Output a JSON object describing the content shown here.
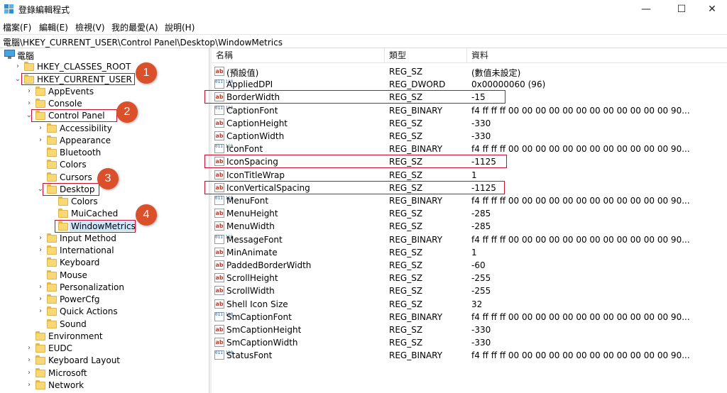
{
  "window": {
    "title": "登錄編輯程式"
  },
  "title_buttons": {
    "minimize": "—",
    "maximize": "☐",
    "close": "✕"
  },
  "menu": [
    "檔案(F)",
    "編輯(E)",
    "檢視(V)",
    "我的最愛(A)",
    "說明(H)"
  ],
  "address": "電腦\\HKEY_CURRENT_USER\\Control Panel\\Desktop\\WindowMetrics",
  "tree": [
    {
      "label": "電腦",
      "level": 0,
      "expander": "⌄",
      "icon": "computer-icon"
    },
    {
      "label": "HKEY_CLASSES_ROOT",
      "level": 1,
      "expander": "›"
    },
    {
      "label": "HKEY_CURRENT_USER",
      "level": 1,
      "expander": "⌄"
    },
    {
      "label": "AppEvents",
      "level": 2,
      "expander": "›"
    },
    {
      "label": "Console",
      "level": 2,
      "expander": "›"
    },
    {
      "label": "Control Panel",
      "level": 2,
      "expander": "⌄"
    },
    {
      "label": "Accessibility",
      "level": 3,
      "expander": "›"
    },
    {
      "label": "Appearance",
      "level": 3,
      "expander": "›"
    },
    {
      "label": "Bluetooth",
      "level": 3,
      "expander": ""
    },
    {
      "label": "Colors",
      "level": 3,
      "expander": ""
    },
    {
      "label": "Cursors",
      "level": 3,
      "expander": ""
    },
    {
      "label": "Desktop",
      "level": 3,
      "expander": "⌄"
    },
    {
      "label": "Colors",
      "level": 4,
      "expander": ""
    },
    {
      "label": "MuiCached",
      "level": 4,
      "expander": ""
    },
    {
      "label": "WindowMetrics",
      "level": 4,
      "expander": "",
      "selected": true
    },
    {
      "label": "Input Method",
      "level": 3,
      "expander": "›"
    },
    {
      "label": "International",
      "level": 3,
      "expander": "›"
    },
    {
      "label": "Keyboard",
      "level": 3,
      "expander": ""
    },
    {
      "label": "Mouse",
      "level": 3,
      "expander": ""
    },
    {
      "label": "Personalization",
      "level": 3,
      "expander": "›"
    },
    {
      "label": "PowerCfg",
      "level": 3,
      "expander": "›"
    },
    {
      "label": "Quick Actions",
      "level": 3,
      "expander": "›"
    },
    {
      "label": "Sound",
      "level": 3,
      "expander": ""
    },
    {
      "label": "Environment",
      "level": 2,
      "expander": ""
    },
    {
      "label": "EUDC",
      "level": 2,
      "expander": "›"
    },
    {
      "label": "Keyboard Layout",
      "level": 2,
      "expander": "›"
    },
    {
      "label": "Microsoft",
      "level": 2,
      "expander": "›"
    },
    {
      "label": "Network",
      "level": 2,
      "expander": "›"
    }
  ],
  "columns": {
    "name": "名稱",
    "type": "類型",
    "data": "資料"
  },
  "values": [
    {
      "name": "(預設值)",
      "type": "REG_SZ",
      "data": "(數值未設定)",
      "kind": "sz"
    },
    {
      "name": "AppliedDPI",
      "type": "REG_DWORD",
      "data": "0x00000060 (96)",
      "kind": "bin"
    },
    {
      "name": "BorderWidth",
      "type": "REG_SZ",
      "data": "-15",
      "kind": "sz",
      "highlight": true
    },
    {
      "name": "CaptionFont",
      "type": "REG_BINARY",
      "data": "f4 ff ff ff 00 00 00 00 00 00 00 00 00 00 00 00 90...",
      "kind": "bin"
    },
    {
      "name": "CaptionHeight",
      "type": "REG_SZ",
      "data": "-330",
      "kind": "sz"
    },
    {
      "name": "CaptionWidth",
      "type": "REG_SZ",
      "data": "-330",
      "kind": "sz"
    },
    {
      "name": "IconFont",
      "type": "REG_BINARY",
      "data": "f4 ff ff ff 00 00 00 00 00 00 00 00 00 00 00 00 90...",
      "kind": "bin"
    },
    {
      "name": "IconSpacing",
      "type": "REG_SZ",
      "data": "-1125",
      "kind": "sz",
      "highlight": true
    },
    {
      "name": "IconTitleWrap",
      "type": "REG_SZ",
      "data": "1",
      "kind": "sz"
    },
    {
      "name": "IconVerticalSpacing",
      "type": "REG_SZ",
      "data": "-1125",
      "kind": "sz",
      "highlight": true
    },
    {
      "name": "MenuFont",
      "type": "REG_BINARY",
      "data": "f4 ff ff ff 00 00 00 00 00 00 00 00 00 00 00 00 90...",
      "kind": "bin"
    },
    {
      "name": "MenuHeight",
      "type": "REG_SZ",
      "data": "-285",
      "kind": "sz"
    },
    {
      "name": "MenuWidth",
      "type": "REG_SZ",
      "data": "-285",
      "kind": "sz"
    },
    {
      "name": "MessageFont",
      "type": "REG_BINARY",
      "data": "f4 ff ff ff 00 00 00 00 00 00 00 00 00 00 00 00 90...",
      "kind": "bin"
    },
    {
      "name": "MinAnimate",
      "type": "REG_SZ",
      "data": "1",
      "kind": "sz"
    },
    {
      "name": "PaddedBorderWidth",
      "type": "REG_SZ",
      "data": "-60",
      "kind": "sz"
    },
    {
      "name": "ScrollHeight",
      "type": "REG_SZ",
      "data": "-255",
      "kind": "sz"
    },
    {
      "name": "ScrollWidth",
      "type": "REG_SZ",
      "data": "-255",
      "kind": "sz"
    },
    {
      "name": "Shell Icon Size",
      "type": "REG_SZ",
      "data": "32",
      "kind": "sz"
    },
    {
      "name": "SmCaptionFont",
      "type": "REG_BINARY",
      "data": "f4 ff ff ff 00 00 00 00 00 00 00 00 00 00 00 00 90...",
      "kind": "bin"
    },
    {
      "name": "SmCaptionHeight",
      "type": "REG_SZ",
      "data": "-330",
      "kind": "sz"
    },
    {
      "name": "SmCaptionWidth",
      "type": "REG_SZ",
      "data": "-330",
      "kind": "sz"
    },
    {
      "name": "StatusFont",
      "type": "REG_BINARY",
      "data": "f4 ff ff ff 00 00 00 00 00 00 00 00 00 00 00 00 90...",
      "kind": "bin"
    }
  ],
  "callouts": [
    "1",
    "2",
    "3",
    "4"
  ],
  "icons": {
    "string_value": "ab",
    "binary_value": "011 110"
  },
  "colors": {
    "callout": "#d9502a",
    "highlight_box": "#c8102e",
    "selection": "#cce8ff"
  }
}
